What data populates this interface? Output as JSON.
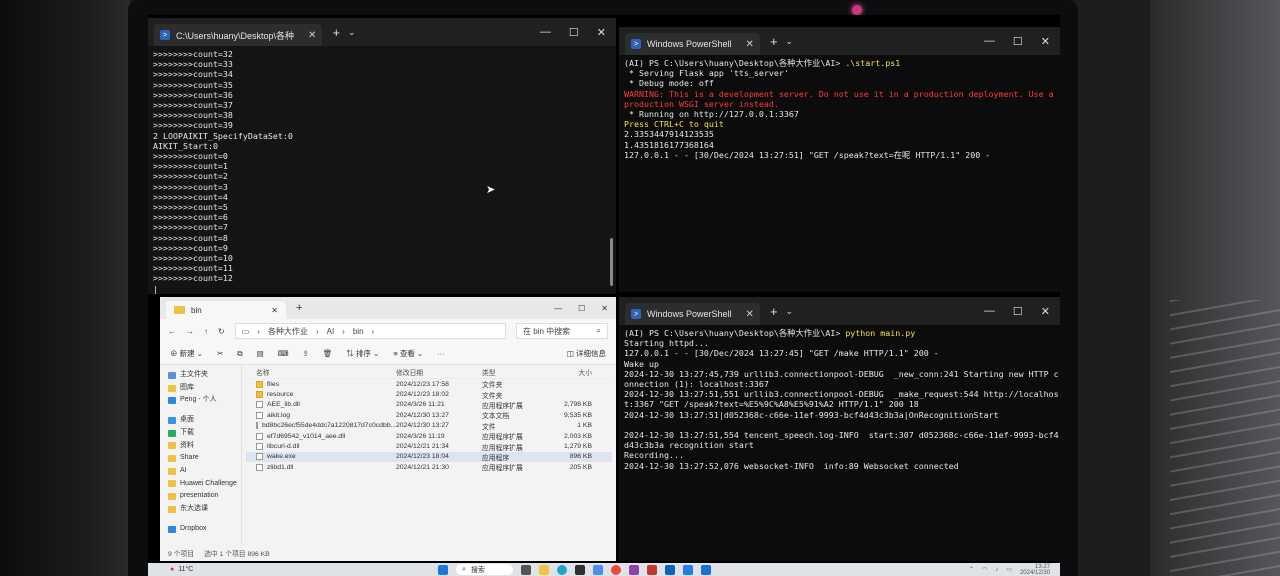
{
  "cmd_window": {
    "tab_title": "C:\\Users\\huany\\Desktop\\各种",
    "lines": [
      ">>>>>>>>count=32",
      ">>>>>>>>count=33",
      ">>>>>>>>count=34",
      ">>>>>>>>count=35",
      ">>>>>>>>count=36",
      ">>>>>>>>count=37",
      ">>>>>>>>count=38",
      ">>>>>>>>count=39",
      "2 LOOPAIKIT_SpecifyDataSet:0",
      "AIKIT_Start:0",
      ">>>>>>>>count=0",
      ">>>>>>>>count=1",
      ">>>>>>>>count=2",
      ">>>>>>>>count=3",
      ">>>>>>>>count=4",
      ">>>>>>>>count=5",
      ">>>>>>>>count=6",
      ">>>>>>>>count=7",
      ">>>>>>>>count=8",
      ">>>>>>>>count=9",
      ">>>>>>>>count=10",
      ">>>>>>>>count=11",
      ">>>>>>>>count=12",
      "|"
    ]
  },
  "ps_top": {
    "tab_title": "Windows PowerShell",
    "prompt": "(AI) PS C:\\Users\\huany\\Desktop\\各种大作业\\AI> ",
    "command": ".\\start.ps1",
    "line1": " * Serving Flask app 'tts_server'",
    "line2": " * Debug mode: off",
    "warning": "WARNING: This is a development server. Do not use it in a production deployment. Use a\nproduction WSGI server instead.",
    "line3": " * Running on http://127.0.0.1:3367",
    "quit": "Press CTRL+C to quit",
    "line4": "2.3353447914123535",
    "line5": "1.4351816177368164",
    "line6": "127.0.0.1 - - [30/Dec/2024 13:27:51] \"GET /speak?text=在呢 HTTP/1.1\" 200 -"
  },
  "ps_bottom": {
    "tab_title": "Windows PowerShell",
    "prompt": "(AI) PS C:\\Users\\huany\\Desktop\\各种大作业\\AI> ",
    "command": "python main.py",
    "body": "Starting httpd...\n127.0.0.1 - - [30/Dec/2024 13:27:45] \"GET /make HTTP/1.1\" 200 -\nWake up\n2024-12-30 13:27:45,739 urllib3.connectionpool-DEBUG  _new_conn:241 Starting new HTTP c\nonnection (1): localhost:3367\n2024-12-30 13:27:51,551 urllib3.connectionpool-DEBUG  _make_request:544 http://localhos\nt:3367 \"GET /speak?text=%E5%9C%A8%E5%91%A2 HTTP/1.1\" 200 18\n2024-12-30 13:27:51|d052368c-c66e-11ef-9993-bcf4d43c3b3a|OnRecognitionStart\n\n2024-12-30 13:27:51,554 tencent_speech.log-INFO  start:307 d052368c-c66e-11ef-9993-bcf4\nd43c3b3a recognition start\nRecording...\n2024-12-30 13:27:52,076 websocket-INFO  info:89 Websocket connected"
  },
  "explorer": {
    "tab_title": "bin",
    "breadcrumb": [
      "各种大作业",
      "AI",
      "bin"
    ],
    "search_placeholder": "在 bin 中搜索",
    "toolbar": {
      "new": "新建",
      "sort": "排序",
      "view": "查看",
      "details": "详细信息"
    },
    "nav": [
      "主文件夹",
      "图库",
      "Peng - 个人",
      "桌面",
      "下载",
      "资料",
      "Share",
      "AI",
      "Huawei Challenge",
      "presentation",
      "东大选课",
      "Dropbox"
    ],
    "columns": {
      "name": "名称",
      "date": "修改日期",
      "type": "类型",
      "size": "大小"
    },
    "files": [
      {
        "name": "files",
        "date": "2024/12/23 17:58",
        "type": "文件夹",
        "size": "",
        "folder": true
      },
      {
        "name": "resource",
        "date": "2024/12/23 18:02",
        "type": "文件夹",
        "size": "",
        "folder": true
      },
      {
        "name": "AEE_lib.dll",
        "date": "2024/3/26 11:21",
        "type": "应用程序扩展",
        "size": "2,798 KB"
      },
      {
        "name": "aikit.log",
        "date": "2024/12/30 13:27",
        "type": "文本文档",
        "size": "9,535 KB"
      },
      {
        "name": "bd8bc26ecf55de4ddc7a1220817d7c0cdbb...",
        "date": "2024/12/30 13:27",
        "type": "文件",
        "size": "1 KB"
      },
      {
        "name": "ef7d69542_v1014_aee.dll",
        "date": "2024/3/26 11:19",
        "type": "应用程序扩展",
        "size": "2,003 KB"
      },
      {
        "name": "libcurl-d.dll",
        "date": "2024/12/21 21:34",
        "type": "应用程序扩展",
        "size": "1,279 KB"
      },
      {
        "name": "wake.exe",
        "date": "2024/12/23 18:04",
        "type": "应用程序",
        "size": "896 KB",
        "selected": true
      },
      {
        "name": "zlibd1.dll",
        "date": "2024/12/21 21:30",
        "type": "应用程序扩展",
        "size": "205 KB"
      }
    ],
    "status": {
      "count": "9 个项目",
      "selection": "选中 1 个项目  896 KB"
    }
  },
  "taskbar": {
    "weather": "11°C",
    "search": "搜索",
    "time": "13:27",
    "date": "2024/12/30"
  },
  "colors": {
    "warning": "#ff3b3b",
    "highlight": "#f2e34c",
    "selection": "#dbe4ef"
  }
}
